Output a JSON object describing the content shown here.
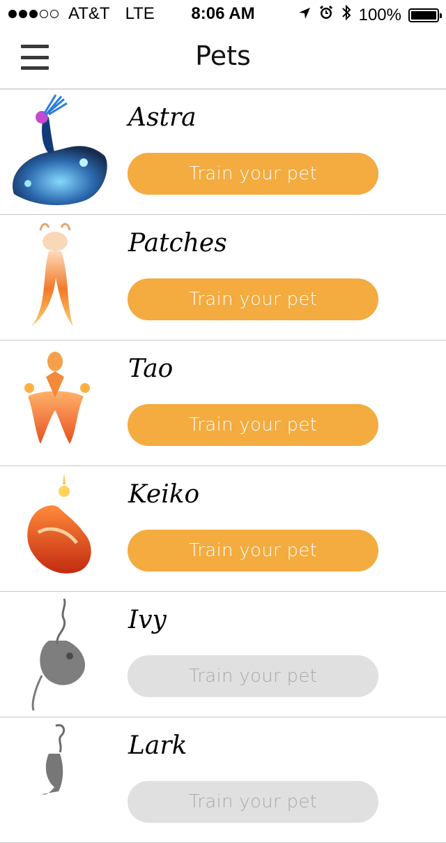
{
  "status_bar": {
    "signal_bars_filled": 3,
    "signal_bars_total": 5,
    "carrier": "AT&T",
    "network": "LTE",
    "time": "8:06 AM",
    "battery": "100%",
    "icons": [
      "location-arrow-icon",
      "alarm-icon",
      "bluetooth-icon",
      "battery-icon"
    ]
  },
  "nav": {
    "title": "Pets",
    "menu_icon": "hamburger-menu-icon"
  },
  "colors": {
    "button_active": "#f4ab3f",
    "button_locked": "#e0e0e0",
    "divider": "#c8c8c8"
  },
  "pets": [
    {
      "name": "Astra",
      "button_label": "Train your pet",
      "locked": false,
      "art": "astra-pet-icon"
    },
    {
      "name": "Patches",
      "button_label": "Train your pet",
      "locked": false,
      "art": "patches-pet-icon"
    },
    {
      "name": "Tao",
      "button_label": "Train your pet",
      "locked": false,
      "art": "tao-pet-icon"
    },
    {
      "name": "Keiko",
      "button_label": "Train your pet",
      "locked": false,
      "art": "keiko-pet-icon"
    },
    {
      "name": "Ivy",
      "button_label": "Train your pet",
      "locked": true,
      "art": "ivy-pet-icon"
    },
    {
      "name": "Lark",
      "button_label": "Train your pet",
      "locked": true,
      "art": "lark-pet-icon"
    }
  ]
}
